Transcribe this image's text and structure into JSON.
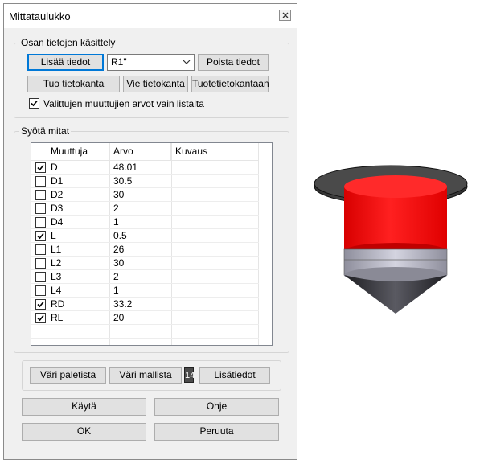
{
  "window": {
    "title": "Mittataulukko"
  },
  "group_data": {
    "legend": "Osan tietojen käsittely",
    "add_label": "Lisää tiedot",
    "selected_value": "R1\"",
    "delete_label": "Poista tiedot",
    "import_label": "Tuo tietokanta",
    "export_label": "Vie tietokanta",
    "product_db_label": "Tuotetietokantaan",
    "only_from_list_label": "Valittujen muuttujien arvot vain listalta",
    "only_from_list_checked": true
  },
  "group_dims": {
    "legend": "Syötä mitat",
    "columns": [
      "Muuttuja",
      "Arvo",
      "Kuvaus"
    ],
    "rows": [
      {
        "name": "D",
        "value": "48.01",
        "description": "",
        "checked": true
      },
      {
        "name": "D1",
        "value": "30.5",
        "description": "",
        "checked": false
      },
      {
        "name": "D2",
        "value": "30",
        "description": "",
        "checked": false
      },
      {
        "name": "D3",
        "value": "2",
        "description": "",
        "checked": false
      },
      {
        "name": "D4",
        "value": "1",
        "description": "",
        "checked": false
      },
      {
        "name": "L",
        "value": "0.5",
        "description": "",
        "checked": true
      },
      {
        "name": "L1",
        "value": "26",
        "description": "",
        "checked": false
      },
      {
        "name": "L2",
        "value": "30",
        "description": "",
        "checked": false
      },
      {
        "name": "L3",
        "value": "2",
        "description": "",
        "checked": false
      },
      {
        "name": "L4",
        "value": "1",
        "description": "",
        "checked": false
      },
      {
        "name": "RD",
        "value": "33.2",
        "description": "",
        "checked": true
      },
      {
        "name": "RL",
        "value": "20",
        "description": "",
        "checked": true
      }
    ]
  },
  "color_bar": {
    "palette_label": "Väri paletista",
    "model_label": "Väri mallista",
    "number": "14",
    "more_label": "Lisätiedot"
  },
  "footer": {
    "apply_label": "Käytä",
    "help_label": "Ohje",
    "ok_label": "OK",
    "cancel_label": "Peruuta"
  },
  "preview": {
    "icon": "part-preview-image",
    "colors": {
      "flange": "#5a5a5a",
      "body": "#ff1a1a",
      "ring": "#b8b8c6",
      "cone": "#3c3c42"
    }
  },
  "colors": {
    "accent": "#0078d7",
    "dialog_bg": "#f0f0f0"
  }
}
